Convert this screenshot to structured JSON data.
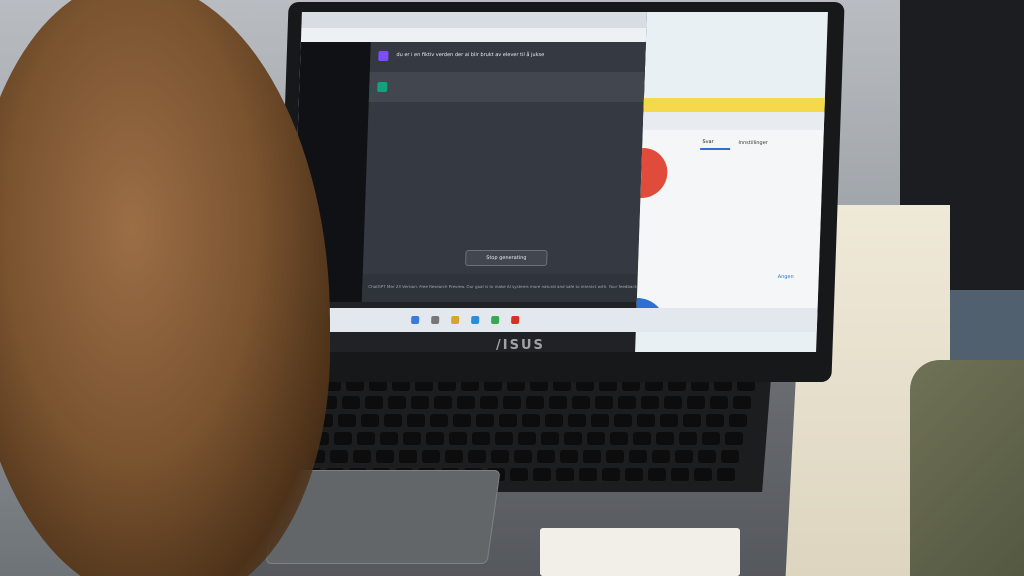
{
  "browser": {
    "prompt_text": "du er i en fiktiv verden der ai blir brukt av elever til å jukse",
    "stop_button_label": "Stop generating",
    "footer_text": "ChatGPT Mar 23 Version. Free Research Preview. Our goal is to make AI systems more natural and safe to interact with. Your feedback will help us improve."
  },
  "right_app": {
    "tab_label": "Svar",
    "tab_label_2": "Innstillinger",
    "button_label": "Angen"
  },
  "laptop": {
    "brand_logo": "/ISUS"
  },
  "colors": {
    "screen_bg": "#e9f0f4",
    "chat_bg": "#353a42",
    "yellow_bar": "#f5d94a",
    "hair": "#7a532f"
  }
}
